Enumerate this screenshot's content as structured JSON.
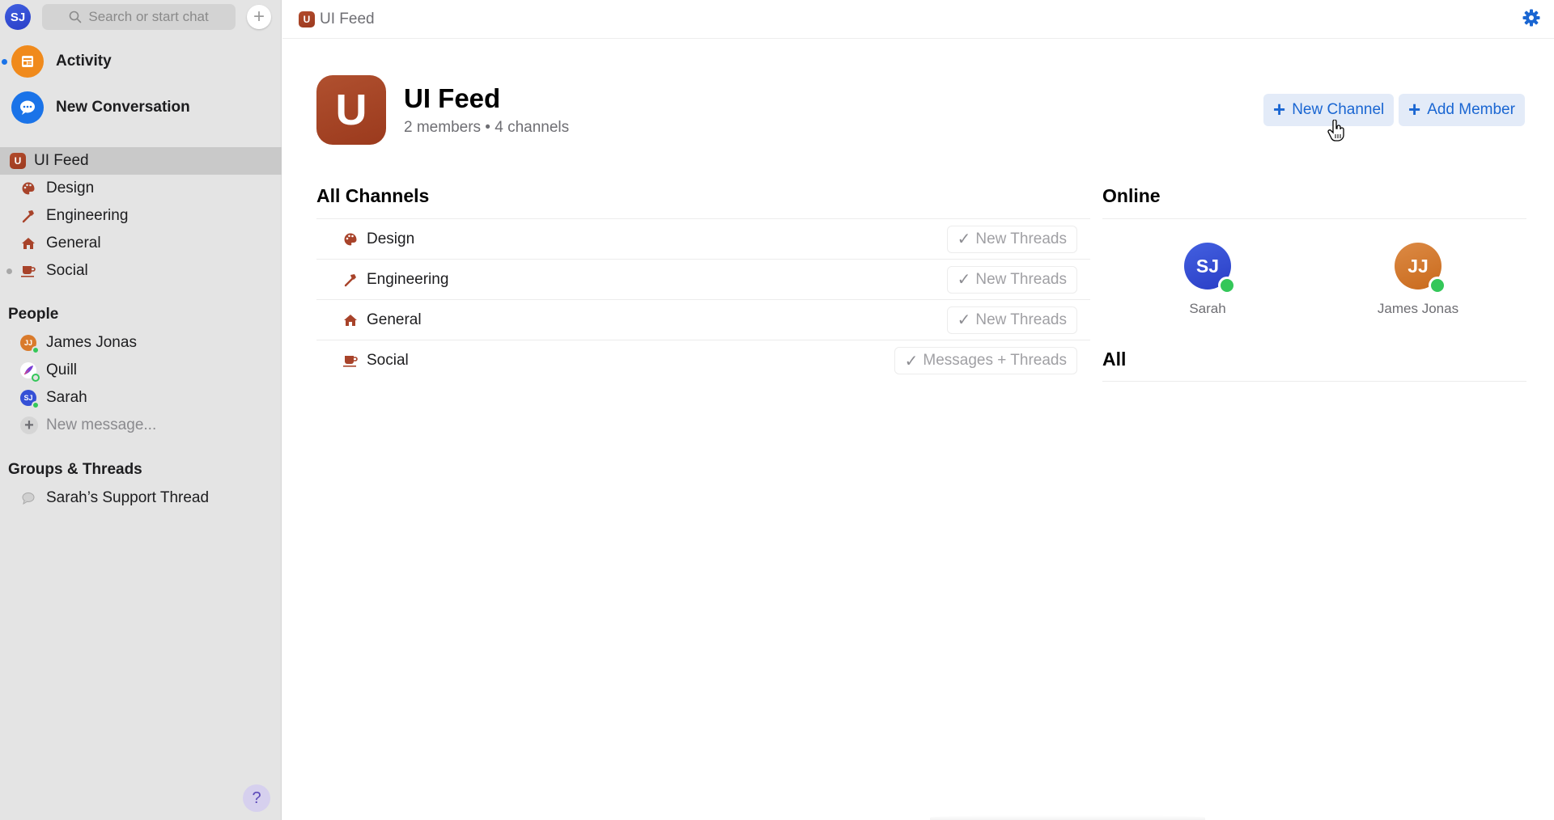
{
  "sidebar": {
    "self_avatar_initials": "SJ",
    "search_placeholder": "Search or start chat",
    "compose_icon": "plus-icon",
    "activity": {
      "label": "Activity",
      "icon": "newspaper-icon",
      "unread": true,
      "color": "#f08a1c"
    },
    "new_conversation": {
      "label": "New Conversation",
      "icon": "chat-bubble-icon",
      "color": "#1a73e8"
    },
    "workspace": {
      "label": "UI Feed",
      "badge": "U",
      "selected": true
    },
    "channels": [
      {
        "label": "Design",
        "icon": "palette-icon",
        "unread": false
      },
      {
        "label": "Engineering",
        "icon": "hammer-icon",
        "unread": false
      },
      {
        "label": "General",
        "icon": "house-icon",
        "unread": false
      },
      {
        "label": "Social",
        "icon": "coffee-cup-icon",
        "unread": true
      }
    ],
    "people_heading": "People",
    "people": [
      {
        "name": "James Jonas",
        "initials": "JJ",
        "color": "#d97a2b",
        "status": "online"
      },
      {
        "name": "Quill",
        "initials": "",
        "color": "#ffffff",
        "status": "away"
      },
      {
        "name": "Sarah",
        "initials": "SJ",
        "color": "#3550d6",
        "status": "online"
      }
    ],
    "new_message_label": "New message...",
    "groups_heading": "Groups & Threads",
    "threads": [
      {
        "label": "Sarah’s Support Thread",
        "icon": "speech-bubble-icon"
      }
    ],
    "help_label": "?"
  },
  "topbar": {
    "badge": "U",
    "title": "UI Feed",
    "settings_icon": "gear-icon"
  },
  "header": {
    "logo_letter": "U",
    "title": "UI Feed",
    "subtitle": "2 members • 4 channels",
    "new_channel_label": "New Channel",
    "add_member_label": "Add Member"
  },
  "channels_section": {
    "heading": "All Channels",
    "rows": [
      {
        "name": "Design",
        "icon": "palette-icon",
        "notification": "New Threads"
      },
      {
        "name": "Engineering",
        "icon": "hammer-icon",
        "notification": "New Threads"
      },
      {
        "name": "General",
        "icon": "house-icon",
        "notification": "New Threads"
      },
      {
        "name": "Social",
        "icon": "coffee-cup-icon",
        "notification": "Messages + Threads"
      }
    ]
  },
  "members_section": {
    "online_heading": "Online",
    "online": [
      {
        "name": "Sarah",
        "initials": "SJ",
        "color": "#3550d6"
      },
      {
        "name": "James Jonas",
        "initials": "JJ",
        "color": "#d97a2b"
      }
    ],
    "all_heading": "All"
  },
  "colors": {
    "accent": "#1a66d2",
    "brand": "#a8432a",
    "online": "#34c759"
  }
}
